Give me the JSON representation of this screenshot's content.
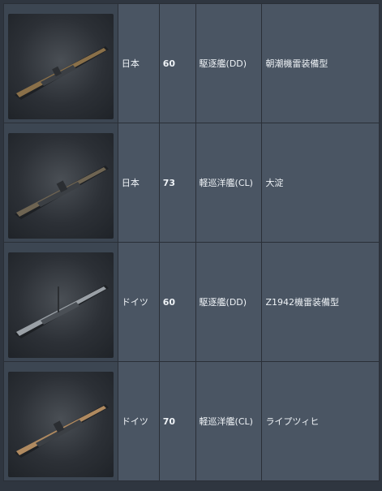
{
  "ships": [
    {
      "image": "ship-thumbnail",
      "nation": "日本",
      "tier": "60",
      "type": "駆逐艦(DD)",
      "name": "朝潮機雷装備型",
      "deck_color": "#8a7049"
    },
    {
      "image": "ship-thumbnail",
      "nation": "日本",
      "tier": "73",
      "type": "軽巡洋艦(CL)",
      "name": "大淀",
      "deck_color": "#8a7049"
    },
    {
      "image": "ship-thumbnail",
      "nation": "ドイツ",
      "tier": "60",
      "type": "駆逐艦(DD)",
      "name": "Z1942機雷装備型",
      "deck_color": "#9aa0a6"
    },
    {
      "image": "ship-thumbnail",
      "nation": "ドイツ",
      "tier": "70",
      "type": "軽巡洋艦(CL)",
      "name": "ライプツィヒ",
      "deck_color": "#b08a60"
    }
  ]
}
